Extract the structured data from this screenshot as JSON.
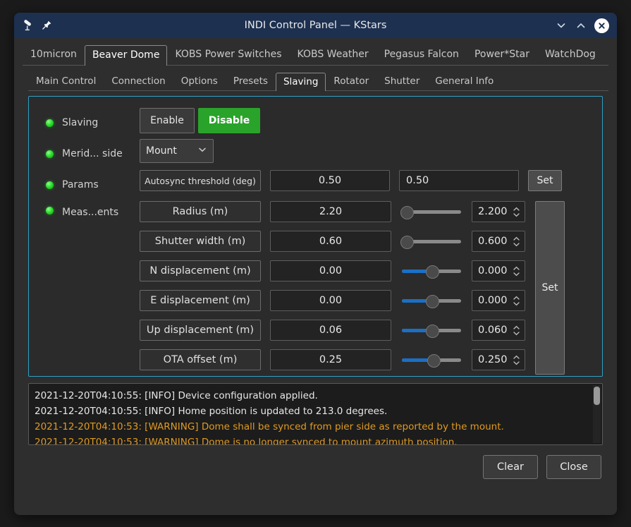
{
  "window": {
    "title": "INDI Control Panel — KStars",
    "icons": {
      "app": "telescope-icon",
      "pin": "pin-icon"
    },
    "controls": {
      "minimize": "chevron-down-icon",
      "maximize": "chevron-up-icon",
      "close": "close-icon"
    }
  },
  "device_tabs": [
    {
      "label": "10micron",
      "active": false
    },
    {
      "label": "Beaver Dome",
      "active": true
    },
    {
      "label": "KOBS Power Switches",
      "active": false
    },
    {
      "label": "KOBS Weather",
      "active": false
    },
    {
      "label": "Pegasus Falcon",
      "active": false
    },
    {
      "label": "Power*Star",
      "active": false
    },
    {
      "label": "WatchDog",
      "active": false
    }
  ],
  "sub_tabs": [
    {
      "label": "Main Control",
      "active": false
    },
    {
      "label": "Connection",
      "active": false
    },
    {
      "label": "Options",
      "active": false
    },
    {
      "label": "Presets",
      "active": false
    },
    {
      "label": "Slaving",
      "active": true
    },
    {
      "label": "Rotator",
      "active": false
    },
    {
      "label": "Shutter",
      "active": false
    },
    {
      "label": "General Info",
      "active": false
    }
  ],
  "panel": {
    "border_color": "#2f9fc4",
    "slaving": {
      "label": "Slaving",
      "led_state": "ok",
      "enable_label": "Enable",
      "disable_label": "Disable",
      "disable_color": "#2aa32a"
    },
    "meridian_side": {
      "label": "Merid... side",
      "led_state": "ok",
      "selected": "Mount"
    },
    "params": {
      "label": "Params",
      "led_state": "ok",
      "name": "Autosync threshold (deg)",
      "value": "0.50",
      "edit_value": "0.50",
      "set_label": "Set"
    },
    "measurements": {
      "label": "Meas...ents",
      "led_state": "ok",
      "set_label": "Set",
      "rows": [
        {
          "name": "Radius (m)",
          "value": "2.20",
          "spin": "2.200",
          "slider_pct": 0,
          "slider_filled": false
        },
        {
          "name": "Shutter width (m)",
          "value": "0.60",
          "spin": "0.600",
          "slider_pct": 0,
          "slider_filled": false
        },
        {
          "name": "N displacement (m)",
          "value": "0.00",
          "spin": "0.000",
          "slider_pct": 50,
          "slider_filled": true
        },
        {
          "name": "E displacement (m)",
          "value": "0.00",
          "spin": "0.000",
          "slider_pct": 50,
          "slider_filled": true
        },
        {
          "name": "Up displacement (m)",
          "value": "0.06",
          "spin": "0.060",
          "slider_pct": 50,
          "slider_filled": true
        },
        {
          "name": "OTA offset (m)",
          "value": "0.25",
          "spin": "0.250",
          "slider_pct": 52,
          "slider_filled": true
        }
      ]
    }
  },
  "log": {
    "lines": [
      {
        "text": "2021-12-20T04:10:55: [INFO] Device configuration applied.",
        "level": "info"
      },
      {
        "text": "2021-12-20T04:10:55: [INFO] Home position is updated to 213.0 degrees.",
        "level": "info"
      },
      {
        "text": "2021-12-20T04:10:53: [WARNING] Dome shall be synced from pier side as reported by the mount.",
        "level": "warning"
      },
      {
        "text": "2021-12-20T04:10:53: [WARNING] Dome is no longer synced to mount azimuth position.",
        "level": "warning"
      }
    ],
    "warning_color": "#e09a20"
  },
  "footer": {
    "clear_label": "Clear",
    "close_label": "Close"
  }
}
